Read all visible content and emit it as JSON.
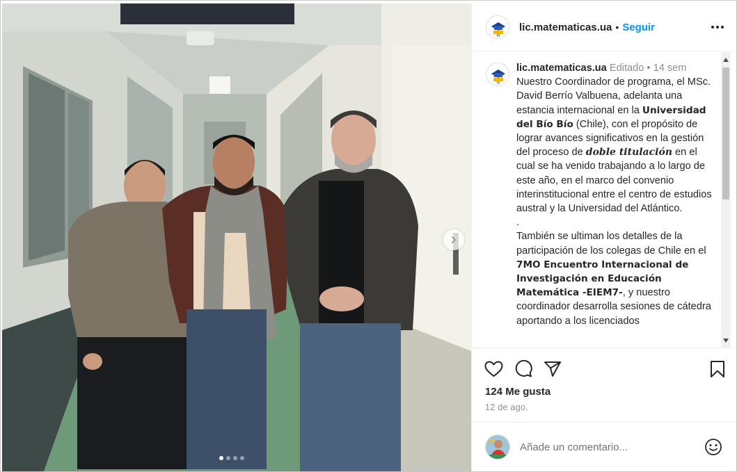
{
  "post": {
    "username": "lic.matematicas.ua",
    "follow_label": "Seguir",
    "separator": "•"
  },
  "caption": {
    "username": "lic.matematicas.ua",
    "edited_label": "Editado",
    "meta_sep": "•",
    "time_ago": "14 sem",
    "p1_a": "Nuestro Coordinador de programa, el MSc. David Berrío Valbuena, adelanta una estancia internacional en la ",
    "p1_bold1": "Universidad del Bío Bío",
    "p1_b": " (Chile), con el propósito de lograr avances significativos en la gestión del proceso de ",
    "p1_bold2": "doble titulación",
    "p1_c": " en el cual se ha venido trabajando a lo largo de este año, en el marco del convenio interinstitucional entre el centro de estudios austral y la Universidad del Atlántico.",
    "dot_line": ".",
    "p2_a": "También se ultiman los detalles de la participación de los colegas de Chile en el ",
    "p2_bold": "7MO Encuentro Internacional de Investigación en Educación Matemática -EIEM7-",
    "p2_b": ", y nuestro coordinador desarrolla sesiones de cátedra aportando a los licenciados"
  },
  "engagement": {
    "likes_text": "124 Me gusta",
    "date_text": "12 de ago."
  },
  "comment": {
    "placeholder": "Añade un comentario..."
  },
  "icons": {
    "more": "more-horizontal-icon",
    "like": "heart-icon",
    "comment": "comment-bubble-icon",
    "share": "paper-plane-icon",
    "save": "bookmark-icon",
    "emoji": "smiley-icon",
    "next": "chevron-right-icon"
  },
  "carousel": {
    "total_slides": 4,
    "active_index": 0
  },
  "colors": {
    "accent": "#0095f6",
    "text": "#262626",
    "muted": "#8e8e8e",
    "border": "#efefef"
  }
}
